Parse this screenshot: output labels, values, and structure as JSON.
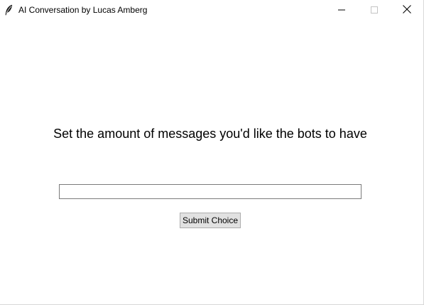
{
  "window": {
    "title": "AI Conversation by Lucas Amberg",
    "app_icon": "feather-icon",
    "controls": {
      "minimize_icon": "minimize-icon",
      "maximize_icon": "maximize-icon",
      "close_icon": "close-icon"
    }
  },
  "main": {
    "prompt": "Set the amount of messages you'd like the bots to have",
    "entry_value": "",
    "submit_label": "Submit Choice"
  }
}
